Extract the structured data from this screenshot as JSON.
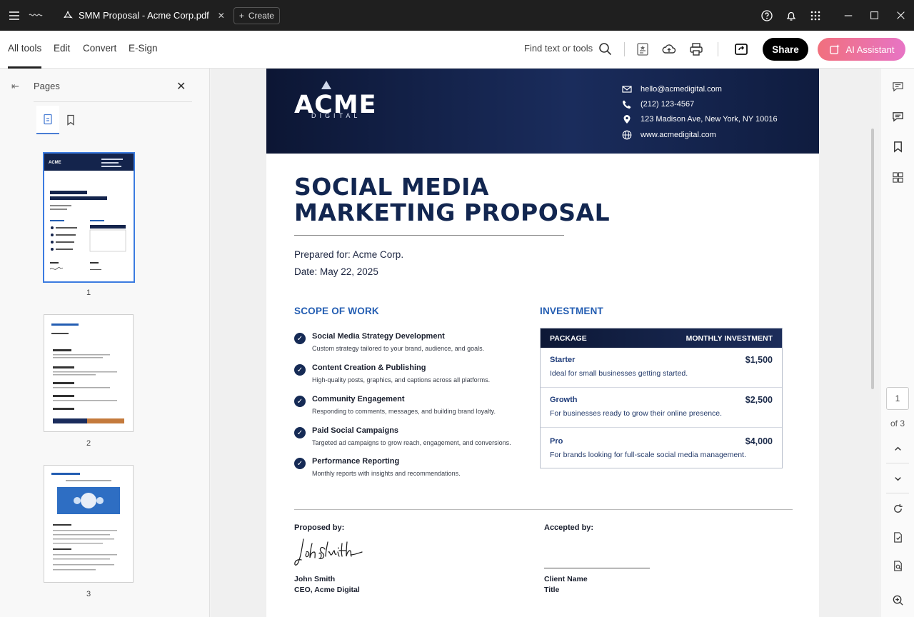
{
  "titlebar": {
    "doc_tab_title": "SMM Proposal - Acme Corp.pdf",
    "create_label": "Create"
  },
  "toolbar": {
    "tabs": [
      "All tools",
      "Edit",
      "Convert",
      "E-Sign"
    ],
    "active_tab": "All tools",
    "find_label": "Find text or tools",
    "share_label": "Share",
    "ai_label": "AI Assistant"
  },
  "left_panel": {
    "title": "Pages",
    "thumbnails": [
      {
        "number": "1",
        "selected": true
      },
      {
        "number": "2",
        "selected": false
      },
      {
        "number": "3",
        "selected": false
      }
    ]
  },
  "document": {
    "header": {
      "logo_main": "ACME",
      "logo_sub": "DIGITAL",
      "email": "hello@acmedigital.com",
      "phone": "(212) 123-4567",
      "address": "123 Madison Ave, New York, NY 10016",
      "website": "www.acmedigital.com"
    },
    "title_line1": "SOCIAL MEDIA",
    "title_line2": "MARKETING PROPOSAL",
    "prepared_for": "Prepared for:  Acme Corp.",
    "date": "Date: May 22, 2025",
    "scope_heading": "SCOPE OF WORK",
    "scope_items": [
      {
        "title": "Social Media Strategy Development",
        "desc": "Custom strategy tailored to your brand, audience, and goals."
      },
      {
        "title": "Content Creation & Publishing",
        "desc": "High-quality posts, graphics, and captions across all platforms."
      },
      {
        "title": "Community Engagement",
        "desc": "Responding to comments, messages, and building brand loyalty."
      },
      {
        "title": "Paid Social Campaigns",
        "desc": "Targeted ad campaigns to grow reach, engagement, and conversions."
      },
      {
        "title": "Performance Reporting",
        "desc": "Monthly reports with insights and recommendations."
      }
    ],
    "investment_heading": "INVESTMENT",
    "investment_table": {
      "col_package": "PACKAGE",
      "col_price": "MONTHLY INVESTMENT",
      "rows": [
        {
          "name": "Starter",
          "price": "$1,500",
          "desc": "Ideal for small businesses getting started."
        },
        {
          "name": "Growth",
          "price": "$2,500",
          "desc": "For businesses ready to grow their online presence."
        },
        {
          "name": "Pro",
          "price": "$4,000",
          "desc": "For brands looking for full-scale social media management."
        }
      ]
    },
    "proposed_by_label": "Proposed by:",
    "signature_text": "John Smith",
    "proposer_name": "John Smith",
    "proposer_title": "CEO, Acme Digital",
    "accepted_by_label": "Accepted by:",
    "client_name_label": "Client Name",
    "client_title_label": "Title"
  },
  "navigator": {
    "current_page": "1",
    "of_pages": "of 3"
  },
  "colors": {
    "navy": "#122650",
    "accent_blue": "#235db2",
    "ai_gradient_start": "#f1707d",
    "ai_gradient_end": "#e774c5"
  }
}
